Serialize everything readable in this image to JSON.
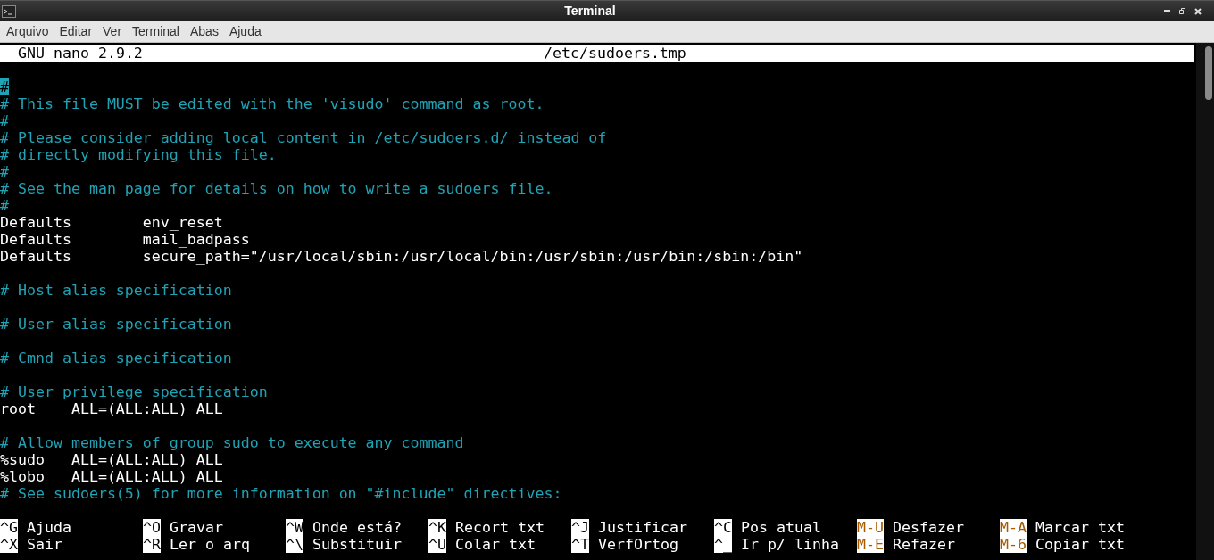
{
  "window": {
    "title": "Terminal"
  },
  "menu": [
    "Arquivo",
    "Editar",
    "Ver",
    "Terminal",
    "Abas",
    "Ajuda"
  ],
  "nano_header": {
    "version": "GNU nano 2.9.2",
    "filename": "/etc/sudoers.tmp"
  },
  "lines": [
    {
      "kind": "blank"
    },
    {
      "kind": "comment",
      "text": "#",
      "cursor": true
    },
    {
      "kind": "comment",
      "text": "# This file MUST be edited with the 'visudo' command as root.",
      "cursor": false
    },
    {
      "kind": "comment",
      "text": "#",
      "cursor": false
    },
    {
      "kind": "comment",
      "text": "# Please consider adding local content in /etc/sudoers.d/ instead of",
      "cursor": false
    },
    {
      "kind": "comment",
      "text": "# directly modifying this file.",
      "cursor": false
    },
    {
      "kind": "comment",
      "text": "#",
      "cursor": false
    },
    {
      "kind": "comment",
      "text": "# See the man page for details on how to write a sudoers file.",
      "cursor": false
    },
    {
      "kind": "comment",
      "text": "#",
      "cursor": false
    },
    {
      "kind": "code",
      "text": "Defaults        env_reset",
      "cursor": false
    },
    {
      "kind": "code",
      "text": "Defaults        mail_badpass",
      "cursor": false
    },
    {
      "kind": "code",
      "text": "Defaults        secure_path=\"/usr/local/sbin:/usr/local/bin:/usr/sbin:/usr/bin:/sbin:/bin\"",
      "cursor": false
    },
    {
      "kind": "blank"
    },
    {
      "kind": "comment",
      "text": "# Host alias specification",
      "cursor": false
    },
    {
      "kind": "blank"
    },
    {
      "kind": "comment",
      "text": "# User alias specification",
      "cursor": false
    },
    {
      "kind": "blank"
    },
    {
      "kind": "comment",
      "text": "# Cmnd alias specification",
      "cursor": false
    },
    {
      "kind": "blank"
    },
    {
      "kind": "comment",
      "text": "# User privilege specification",
      "cursor": false
    },
    {
      "kind": "code",
      "text": "root    ALL=(ALL:ALL) ALL",
      "cursor": false
    },
    {
      "kind": "blank"
    },
    {
      "kind": "comment",
      "text": "# Allow members of group sudo to execute any command",
      "cursor": false
    },
    {
      "kind": "code",
      "text": "%sudo   ALL=(ALL:ALL) ALL",
      "cursor": false
    },
    {
      "kind": "code",
      "text": "%lobo   ALL=(ALL:ALL) ALL",
      "cursor": false
    },
    {
      "kind": "comment",
      "text": "# See sudoers(5) for more information on \"#include\" directives:",
      "cursor": false
    },
    {
      "kind": "blank"
    }
  ],
  "shortcuts": [
    [
      {
        "key": "^G",
        "kind": "ctrl",
        "label": "Ajuda"
      },
      {
        "key": "^O",
        "kind": "ctrl",
        "label": "Gravar"
      },
      {
        "key": "^W",
        "kind": "ctrl",
        "label": "Onde está?"
      },
      {
        "key": "^K",
        "kind": "ctrl",
        "label": "Recort txt"
      },
      {
        "key": "^J",
        "kind": "ctrl",
        "label": "Justificar"
      },
      {
        "key": "^C",
        "kind": "ctrl",
        "label": "Pos atual"
      },
      {
        "key": "M-U",
        "kind": "meta",
        "label": "Desfazer"
      },
      {
        "key": "M-A",
        "kind": "meta",
        "label": "Marcar txt"
      }
    ],
    [
      {
        "key": "^X",
        "kind": "ctrl",
        "label": "Sair"
      },
      {
        "key": "^R",
        "kind": "ctrl",
        "label": "Ler o arq"
      },
      {
        "key": "^\\",
        "kind": "ctrl",
        "label": "Substituir"
      },
      {
        "key": "^U",
        "kind": "ctrl",
        "label": "Colar txt"
      },
      {
        "key": "^T",
        "kind": "ctrl",
        "label": "VerfOrtog"
      },
      {
        "key": "^_",
        "kind": "ctrl",
        "label": "Ir p/ linha"
      },
      {
        "key": "M-E",
        "kind": "meta",
        "label": "Refazer"
      },
      {
        "key": "M-6",
        "kind": "meta",
        "label": "Copiar txt"
      }
    ]
  ]
}
